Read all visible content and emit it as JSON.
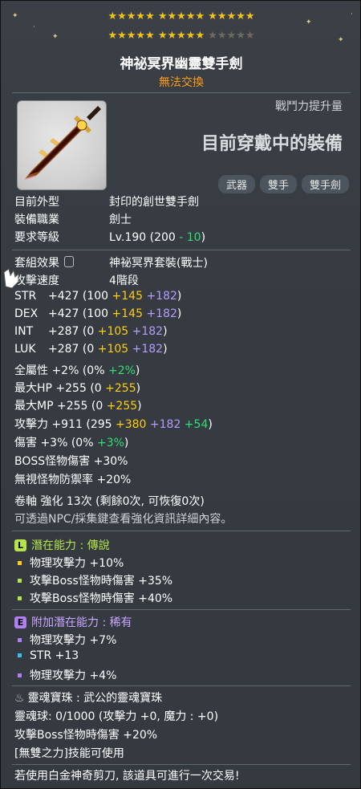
{
  "stars": {
    "row1": "★★★★★ ★★★★★ ★★★★★",
    "row2": "★★★★★ ★★★★★",
    "row2_empty": "★★★★★"
  },
  "item": {
    "name": "神祕冥界幽靈雙手劍",
    "trade": "無法交換"
  },
  "header": {
    "power_label": "戰鬥力提升量",
    "equipped_label": "目前穿戴中的裝備",
    "tags": [
      "武器",
      "雙手",
      "雙手劍"
    ]
  },
  "info": {
    "look_label": "目前外型",
    "look_value": "封印的創世雙手劍",
    "job_label": "裝備職業",
    "job_value": "劍士",
    "req_label": "要求等級",
    "req_a": "Lv.190 (200 ",
    "req_b": "- 10",
    ")": ")",
    "set_label": "套組效果",
    "set_value": "神祕冥界套裝(戰士)",
    "speed_label": "攻擊速度",
    "speed_value": "4階段"
  },
  "stats": [
    {
      "name": "STR",
      "total": "+427",
      "base": "(100",
      "a": "+145",
      "b": "+182",
      "c": "",
      "end": ")"
    },
    {
      "name": "DEX",
      "total": "+427",
      "base": "(100",
      "a": "+145",
      "b": "+182",
      "c": "",
      "end": ")"
    },
    {
      "name": "INT",
      "total": "+287",
      "base": "(0",
      "a": "+105",
      "b": "+182",
      "c": "",
      "end": ")"
    },
    {
      "name": "LUK",
      "total": "+287",
      "base": "(0",
      "a": "+105",
      "b": "+182",
      "c": "",
      "end": ")"
    }
  ],
  "misc": {
    "allstat": "全屬性  +2% (0% ",
    "allstat_g": "+2%",
    "allstat_end": ")",
    "hp": "最大HP  +255 (0 ",
    "hp_y": "+255",
    "hp_end": ")",
    "mp": "最大MP  +255 (0 ",
    "mp_y": "+255",
    "mp_end": ")",
    "atk": "攻擊力  +911 (295 ",
    "atk_y": "+380",
    "atk_p": " +182",
    "atk_g": " +54",
    "atk_end": ")",
    "dmg": "傷害  +3% (0% ",
    "dmg_g": "+3%",
    "dmg_end": ")",
    "boss": "BOSS怪物傷害  +30%",
    "ied": "無視怪物防禦率  +20%",
    "scroll": "卷軸 強化 13次 (剩餘0次, 可恢復0次)",
    "npc": "可透過NPC/採集鍵查看強化資訊詳細內容。"
  },
  "potential": {
    "label": "潛在能力 : ",
    "rank": "傳說",
    "lines": [
      "物理攻擊力 +10%",
      "攻擊Boss怪物時傷害 +35%",
      "攻擊Boss怪物時傷害 +40%"
    ]
  },
  "additional": {
    "label": "附加潛在能力 : ",
    "rank": "稀有",
    "lines": [
      "物理攻擊力 +7%",
      "STR +13",
      "物理攻擊力 +4%"
    ]
  },
  "soul": {
    "header": "靈魂寶珠 : 武公的靈魂寶珠",
    "orb": "靈魂球:  0/1000 (攻擊力 +0, 魔力 : +0)",
    "boss": "攻擊Boss怪物時傷害 +20%",
    "skill": "[無雙之力]技能可使用"
  },
  "footer": "若使用白金神奇剪刀, 該道具可進行一次交易!",
  "colors": {
    "potential_legend": "#b6e54a",
    "potential_rare": "#b07ff0",
    "stat_yellow": "#ffcc11",
    "stat_purple": "#b49cff",
    "stat_green": "#33dd77"
  }
}
